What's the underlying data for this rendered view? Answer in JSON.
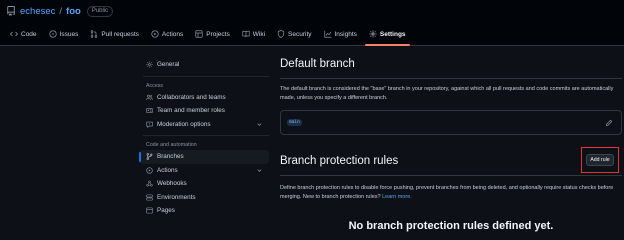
{
  "repo": {
    "owner": "echesec",
    "separator": "/",
    "name": "foo",
    "visibility": "Public"
  },
  "tabs": [
    {
      "label": "Code",
      "icon": "code-icon"
    },
    {
      "label": "Issues",
      "icon": "issue-icon"
    },
    {
      "label": "Pull requests",
      "icon": "pull-request-icon"
    },
    {
      "label": "Actions",
      "icon": "play-icon"
    },
    {
      "label": "Projects",
      "icon": "table-icon"
    },
    {
      "label": "Wiki",
      "icon": "book-icon"
    },
    {
      "label": "Security",
      "icon": "shield-icon"
    },
    {
      "label": "Insights",
      "icon": "graph-icon"
    },
    {
      "label": "Settings",
      "icon": "gear-icon",
      "active": true
    }
  ],
  "sidebar": {
    "general": "General",
    "access_heading": "Access",
    "access_items": [
      {
        "label": "Collaborators and teams",
        "icon": "people-icon"
      },
      {
        "label": "Team and member roles",
        "icon": "id-badge-icon"
      },
      {
        "label": "Moderation options",
        "icon": "report-icon",
        "expandable": true
      }
    ],
    "code_heading": "Code and automation",
    "code_items": [
      {
        "label": "Branches",
        "icon": "branch-icon",
        "active": true
      },
      {
        "label": "Actions",
        "icon": "play-icon",
        "expandable": true
      },
      {
        "label": "Webhooks",
        "icon": "webhook-icon"
      },
      {
        "label": "Environments",
        "icon": "server-icon"
      },
      {
        "label": "Pages",
        "icon": "browser-icon"
      }
    ]
  },
  "main": {
    "default_branch": {
      "title": "Default branch",
      "description": "The default branch is considered the \"base\" branch in your repository, against which all pull requests and code commits are automatically made, unless you specify a different branch.",
      "branch": "main"
    },
    "protection": {
      "title": "Branch protection rules",
      "add_button": "Add rule",
      "description": "Define branch protection rules to disable force pushing, prevent branches from being deleted, and optionally require status checks before merging. New to branch protection rules?",
      "learn_more": "Learn more.",
      "empty_title": "No branch protection rules defined yet."
    }
  },
  "colors": {
    "background": "#0d1117",
    "header": "#010409",
    "link": "#58a6ff",
    "active_tab_underline": "#f78166",
    "highlight_box": "#e5342d"
  }
}
